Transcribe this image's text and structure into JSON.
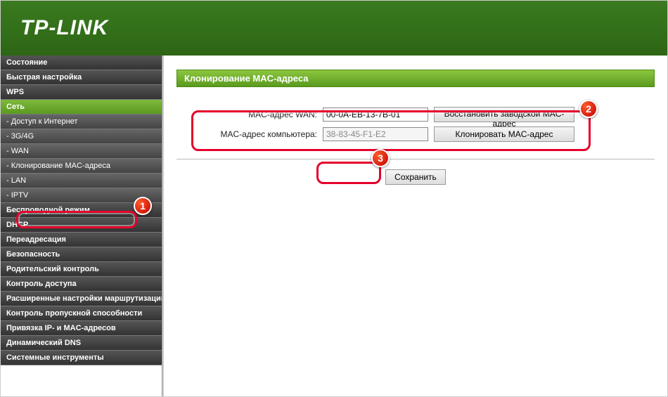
{
  "logo": "TP-LINK",
  "sidebar": {
    "items": [
      {
        "label": "Состояние",
        "type": "section-head"
      },
      {
        "label": "Быстрая настройка",
        "type": "section-head"
      },
      {
        "label": "WPS",
        "type": "section-head"
      },
      {
        "label": "Сеть",
        "type": "active"
      },
      {
        "label": "- Доступ к Интернет",
        "type": "sub"
      },
      {
        "label": "- 3G/4G",
        "type": "sub"
      },
      {
        "label": "- WAN",
        "type": "sub"
      },
      {
        "label": "- Клонирование MAC-адреса",
        "type": "sub highlighted"
      },
      {
        "label": "- LAN",
        "type": "sub"
      },
      {
        "label": "- IPTV",
        "type": "sub"
      },
      {
        "label": "Беспроводной режим",
        "type": "section-head"
      },
      {
        "label": "DHCP",
        "type": "section-head"
      },
      {
        "label": "Переадресация",
        "type": "section-head"
      },
      {
        "label": "Безопасность",
        "type": "section-head"
      },
      {
        "label": "Родительский контроль",
        "type": "section-head"
      },
      {
        "label": "Контроль доступа",
        "type": "section-head"
      },
      {
        "label": "Расширенные настройки маршрутизации",
        "type": "section-head"
      },
      {
        "label": "Контроль пропускной способности",
        "type": "section-head"
      },
      {
        "label": "Привязка IP- и MAC-адресов",
        "type": "section-head"
      },
      {
        "label": "Динамический DNS",
        "type": "section-head"
      },
      {
        "label": "Системные инструменты",
        "type": "section-head"
      }
    ]
  },
  "panel": {
    "title": "Клонирование MAC-адреса",
    "wan_label": "MAC-адрес WAN:",
    "wan_value": "00-0A-EB-13-7B-01",
    "restore_button": "Восстановить заводской MAC-адрес",
    "pc_label": "MAC-адрес компьютера:",
    "pc_value": "38-83-45-F1-E2",
    "clone_button": "Клонировать MAC-адрес",
    "save_button": "Сохранить"
  },
  "callouts": {
    "b1": "1",
    "b2": "2",
    "b3": "3"
  }
}
